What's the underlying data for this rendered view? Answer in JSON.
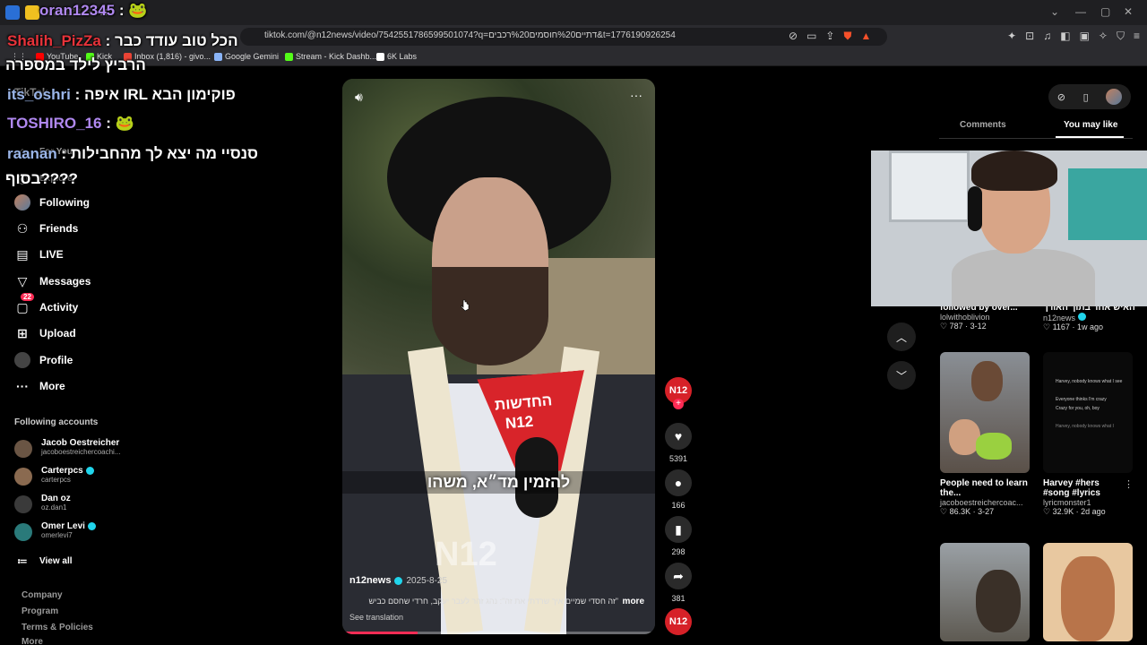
{
  "browser": {
    "tab_title": "oran12345",
    "url": "tiktok.com/@n12news/video/7542551786599501074?q=דתיים%20חוסמים%20רכבים&t=1776190926254",
    "bookmarks": [
      {
        "label": "YouTube",
        "color": "#ff0000"
      },
      {
        "label": "Kick",
        "color": "#53fc18"
      },
      {
        "label": "Inbox (1,816) - givo...",
        "color": "#ea4335"
      },
      {
        "label": "Google Gemini",
        "color": "#8ab4f8"
      },
      {
        "label": "Stream - Kick Dashb...",
        "color": "#53fc18"
      },
      {
        "label": "6K Labs",
        "color": "#ffffff"
      }
    ]
  },
  "chat": [
    {
      "user": "oran12345",
      "sep": " : ",
      "message": "🐸"
    },
    {
      "user": "Shalih_PizZa",
      "sep": " : ",
      "message": "הכל טוב עודד כבר"
    },
    {
      "user": "",
      "sep": "",
      "message": "הרביץ לילד במספרה"
    },
    {
      "user": "its_oshri",
      "sep": " : ",
      "message": "איפה IRL פוקימון הבא"
    },
    {
      "user": "TOSHIRO_16",
      "sep": " : ",
      "message": "🐸"
    },
    {
      "user": "raanan",
      "sep": " : ",
      "message": "סנסיי מה יצא לך מהחבילות"
    },
    {
      "user": "",
      "sep": "",
      "message": "בסוף????"
    }
  ],
  "sidebar": {
    "partial_items": [
      "TikTok",
      "For You",
      "Explore"
    ],
    "items": [
      {
        "label": "Following",
        "icon": "avatar"
      },
      {
        "label": "Friends",
        "icon": "friends-icon"
      },
      {
        "label": "LIVE",
        "icon": "live-icon"
      },
      {
        "label": "Messages",
        "icon": "messages-icon"
      },
      {
        "label": "Activity",
        "icon": "activity-icon",
        "badge": "22"
      },
      {
        "label": "Upload",
        "icon": "upload-icon"
      },
      {
        "label": "Profile",
        "icon": "avatar"
      },
      {
        "label": "More",
        "icon": "more-icon"
      }
    ],
    "following_title": "Following accounts",
    "accounts": [
      {
        "name": "Jacob Oestreicher",
        "handle": "jacoboestreichercoachi...",
        "verified": false
      },
      {
        "name": "Carterpcs",
        "handle": "carterpcs",
        "verified": true
      },
      {
        "name": "Dan oz",
        "handle": "oz.dan1",
        "verified": false
      },
      {
        "name": "Omer Levi",
        "handle": "omerlevi7",
        "verified": true
      }
    ],
    "view_all": "View all",
    "footer": [
      "Company",
      "Program",
      "Terms & Policies",
      "More"
    ]
  },
  "video": {
    "caption": "להזמין מד״א, משהו",
    "mic_label": "החדשות",
    "mic_brand": "N12",
    "watermark": "N12",
    "author": "n12news",
    "date": "2025-8-25",
    "description": "\"זה חסדי שמיים איך שרדתי את זה\": נהג זהר לעבר יעקב, חרדי שחסם כביש",
    "more": "more",
    "see_translation": "See translation",
    "progress": 0.24
  },
  "actions": {
    "avatar_label": "N12",
    "likes": "5391",
    "comments": "166",
    "saves": "298",
    "shares": "381"
  },
  "right_panel": {
    "tabs": [
      "Comments",
      "You may like"
    ],
    "cards": [
      {
        "title": "followed by over...",
        "author": "lolwithoblivion",
        "likes": "787",
        "date": "3-12"
      },
      {
        "title": "האיש אחד בתוך האורך",
        "author": "n12news",
        "likes": "1167",
        "date": "1w ago"
      },
      {
        "title": "People need to learn the...",
        "author": "jacoboestreichercoac...",
        "likes": "86.3K",
        "date": "3-27"
      },
      {
        "title": "Harvey #hers #song #lyrics",
        "author": "lyricmonster1",
        "likes": "32.9K",
        "date": "2d ago"
      }
    ],
    "lyric_lines": [
      "Harvey, nobody knows what I see",
      "Everyone thinks I'm crazy",
      "Crazy for you, oh, boy",
      "Harvey, nobody knows what I"
    ]
  }
}
